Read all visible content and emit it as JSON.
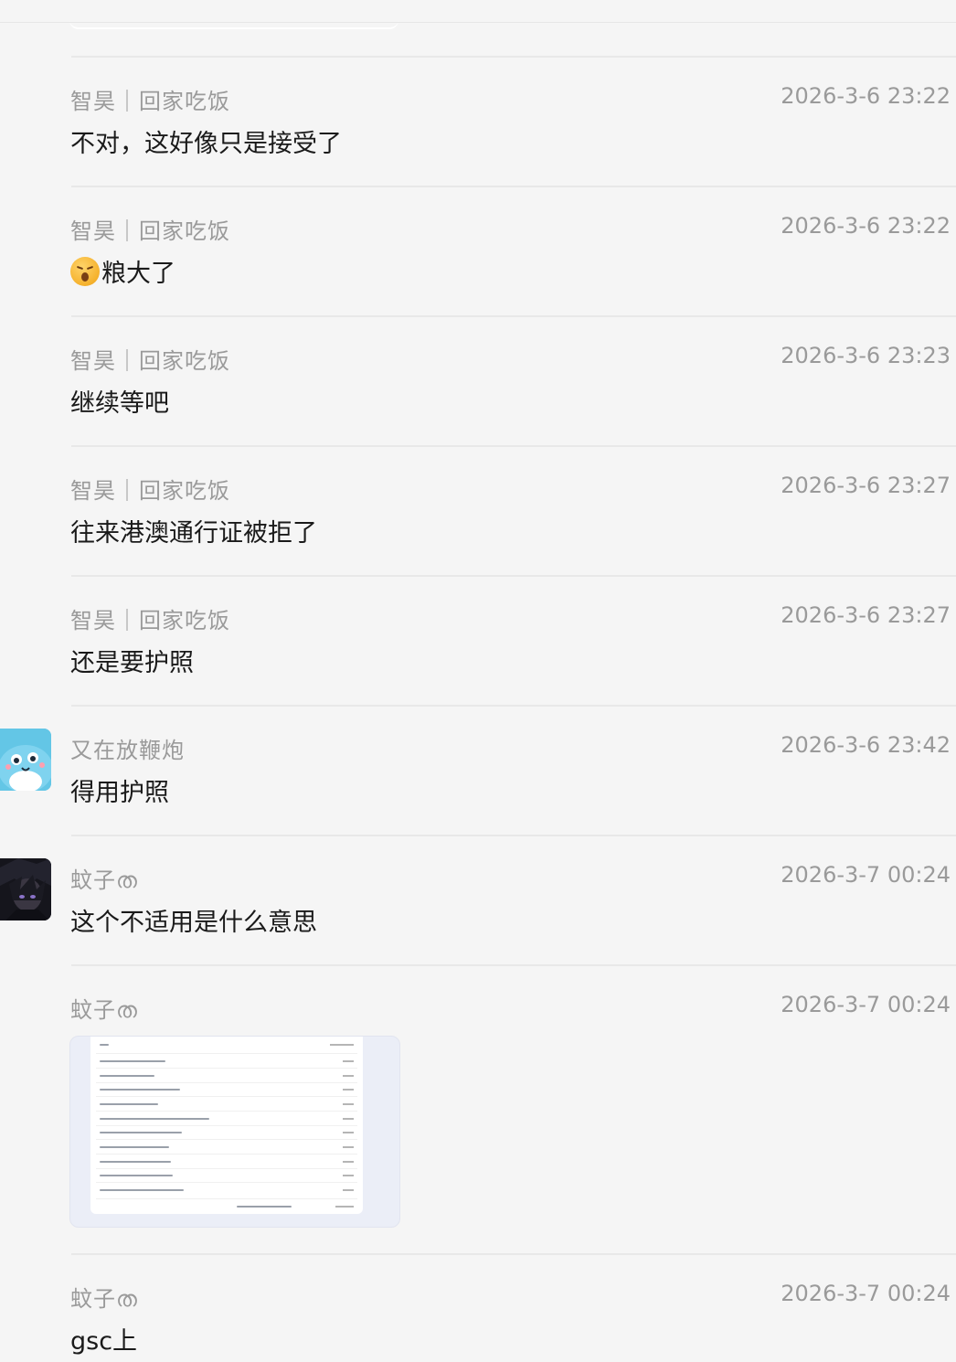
{
  "messages": [
    {
      "sender": "智昊｜回家吃饭",
      "time": "2026-3-6 23:22",
      "text": "不对，这好像只是接受了"
    },
    {
      "sender": "智昊｜回家吃饭",
      "time": "2026-3-6 23:22",
      "text": "粮大了",
      "emoji": "sweat-smile-emoji"
    },
    {
      "sender": "智昊｜回家吃饭",
      "time": "2026-3-6 23:23",
      "text": "继续等吧"
    },
    {
      "sender": "智昊｜回家吃饭",
      "time": "2026-3-6 23:27",
      "text": "往来港澳通行证被拒了"
    },
    {
      "sender": "智昊｜回家吃饭",
      "time": "2026-3-6 23:27",
      "text": "还是要护照"
    },
    {
      "sender": "又在放鞭炮",
      "time": "2026-3-6 23:42",
      "text": "得用护照",
      "avatar": "blue-cat-avatar"
    },
    {
      "sender": "蚊子ത",
      "time": "2026-3-7 00:24",
      "text": "这个不适用是什么意思",
      "avatar": "dark-anime-avatar"
    },
    {
      "sender": "蚊子ത",
      "time": "2026-3-7 00:24",
      "image": "screenshot-thumbnail"
    },
    {
      "sender": "蚊子ത",
      "time": "2026-3-7 00:24",
      "text": "gsc上"
    }
  ]
}
